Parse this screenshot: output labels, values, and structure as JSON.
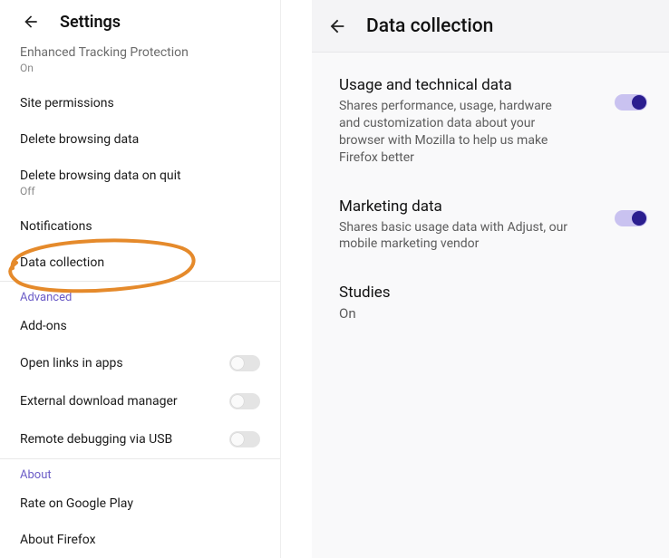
{
  "left": {
    "title": "Settings",
    "rows": [
      {
        "label": "Enhanced Tracking Protection",
        "sub": "On",
        "truncated": true
      },
      {
        "label": "Site permissions"
      },
      {
        "label": "Delete browsing data"
      },
      {
        "label": "Delete browsing data on quit",
        "sub": "Off"
      },
      {
        "label": "Notifications"
      },
      {
        "label": "Data collection"
      }
    ],
    "section_advanced": "Advanced",
    "toggles": [
      {
        "label": "Add-ons",
        "switch": false
      },
      {
        "label": "Open links in apps",
        "switch": true
      },
      {
        "label": "External download manager",
        "switch": true
      },
      {
        "label": "Remote debugging via USB",
        "switch": true
      }
    ],
    "section_about": "About",
    "about_rows": [
      {
        "label": "Rate on Google Play"
      },
      {
        "label": "About Firefox"
      }
    ]
  },
  "right": {
    "title": "Data collection",
    "items": [
      {
        "title": "Usage and technical data",
        "desc": "Shares performance, usage, hardware and customization data about your browser with Mozilla to help us make Firefox better",
        "on": true
      },
      {
        "title": "Marketing data",
        "desc": "Shares basic usage data with Adjust, our mobile marketing vendor",
        "on": true
      },
      {
        "title": "Studies",
        "sub": "On"
      }
    ]
  }
}
